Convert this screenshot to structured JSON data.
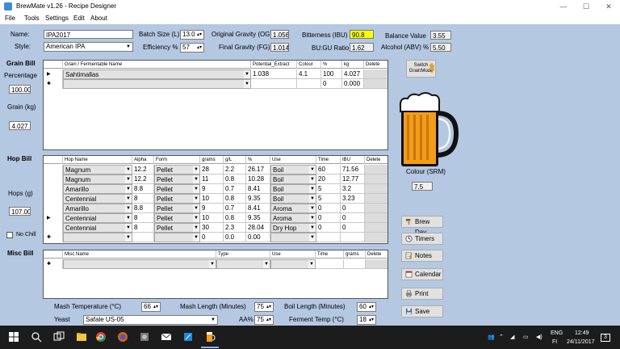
{
  "window": {
    "title": "BrewMate v1.26 - Recipe Designer",
    "controls": [
      "—",
      "☐",
      "✕"
    ]
  },
  "menu": [
    "File",
    "Tools",
    "Settings",
    "Edit",
    "About"
  ],
  "recipe": {
    "name_label": "Name:",
    "name_value": "IPA2017",
    "style_label": "Style:",
    "style_value": "American IPA",
    "batch_label": "Batch Size (L)",
    "batch_value": "13.0",
    "efficiency_label": "Efficiency %",
    "efficiency_value": "57",
    "og_label": "Original Gravity (OG)",
    "og_value": "1.056",
    "fg_label": "Final Gravity (FG)",
    "fg_value": "1.014",
    "ibu_label": "Bitterness (IBU)",
    "ibu_value": "90.8",
    "bugu_label": "BU:GU Ratio",
    "bugu_value": "1.62",
    "balance_label": "Balance Value",
    "balance_value": "3.55",
    "abv_label": "Alcohol (ABV) %",
    "abv_value": "5.50"
  },
  "grain": {
    "section_label": "Grain Bill",
    "percentage_label": "Percentage",
    "percentage_value": "100.00",
    "grain_kg_label": "Grain (kg)",
    "grain_kg_value": "4.027",
    "switch_label_1": "Switch",
    "switch_label_2": "GrainMode",
    "headers": [
      "Grain / Fermentable Name",
      "Potential_Extract",
      "Colour",
      "%",
      "kg",
      "Delete"
    ],
    "rows": [
      {
        "marker": "▶",
        "name": "Sahtimallas",
        "extract": "1.038",
        "colour": "4.1",
        "pct": "100",
        "kg": "4.027"
      },
      {
        "marker": "✱",
        "name": "",
        "extract": "",
        "colour": "",
        "pct": "0",
        "kg": "0.000"
      }
    ]
  },
  "hops": {
    "section_label": "Hop Bill",
    "hops_g_label": "Hops (g)",
    "hops_g_value": "107.00",
    "no_chill_label": "No Chill",
    "headers": [
      "Hop Name",
      "Alpha",
      "Form",
      "grams",
      "g/L",
      "%",
      "Use",
      "Time",
      "IBU",
      "Delete"
    ],
    "rows": [
      {
        "marker": "",
        "name": "Magnum",
        "alpha": "12.2",
        "form": "Pellet",
        "grams": "28",
        "gl": "2.2",
        "pct": "26.17",
        "use": "Boil",
        "time": "60",
        "ibu": "71.56"
      },
      {
        "marker": "",
        "name": "Magnum",
        "alpha": "12.2",
        "form": "Pellet",
        "grams": "11",
        "gl": "0.8",
        "pct": "10.28",
        "use": "Boil",
        "time": "20",
        "ibu": "12.77"
      },
      {
        "marker": "",
        "name": "Amarillo",
        "alpha": "8.8",
        "form": "Pellet",
        "grams": "9",
        "gl": "0.7",
        "pct": "8.41",
        "use": "Boil",
        "time": "5",
        "ibu": "3.2"
      },
      {
        "marker": "",
        "name": "Centennial",
        "alpha": "8",
        "form": "Pellet",
        "grams": "10",
        "gl": "0.8",
        "pct": "9.35",
        "use": "Boil",
        "time": "5",
        "ibu": "3.23"
      },
      {
        "marker": "",
        "name": "Amarillo",
        "alpha": "8.8",
        "form": "Pellet",
        "grams": "9",
        "gl": "0.7",
        "pct": "8.41",
        "use": "Aroma",
        "time": "0",
        "ibu": "0"
      },
      {
        "marker": "▶",
        "name": "Centennial",
        "alpha": "8",
        "form": "Pellet",
        "grams": "10",
        "gl": "0.8",
        "pct": "9.35",
        "use": "Aroma",
        "time": "0",
        "ibu": "0"
      },
      {
        "marker": "",
        "name": "Centennial",
        "alpha": "8",
        "form": "Pellet",
        "grams": "30",
        "gl": "2.3",
        "pct": "28.04",
        "use": "Dry Hop",
        "time": "0",
        "ibu": "0"
      },
      {
        "marker": "✱",
        "name": "",
        "alpha": "",
        "form": "",
        "grams": "0",
        "gl": "0.0",
        "pct": "0.00",
        "use": "",
        "time": "",
        "ibu": ""
      }
    ]
  },
  "misc": {
    "section_label": "Misc Bill",
    "headers": [
      "Misc Name",
      "Type",
      "Use",
      "Time",
      "grams",
      "Delete"
    ],
    "rows": [
      {
        "marker": "✱"
      }
    ]
  },
  "colour": {
    "label": "Colour (SRM)",
    "value": "7.5",
    "beer_color": "#f39c1a"
  },
  "side_buttons": {
    "brew_day": "Brew Day",
    "timers": "Timers",
    "notes": "Notes",
    "calendar": "Calendar",
    "print": "Print",
    "save": "Save"
  },
  "bottom": {
    "mash_temp_label": "Mash Temperature (°C)",
    "mash_temp_value": "66",
    "mash_len_label": "Mash Length (Minutes)",
    "mash_len_value": "75",
    "boil_len_label": "Boil Length (Minutes)",
    "boil_len_value": "60",
    "yeast_label": "Yeast",
    "yeast_value": "Safale US-05",
    "aa_label": "AA%",
    "aa_value": "75",
    "ferment_label": "Ferment Temp (°C)",
    "ferment_value": "18"
  },
  "taskbar": {
    "lang1": "ENG",
    "lang2": "FI",
    "time": "12:49",
    "date": "24/11/2017",
    "notify_count": "3"
  }
}
